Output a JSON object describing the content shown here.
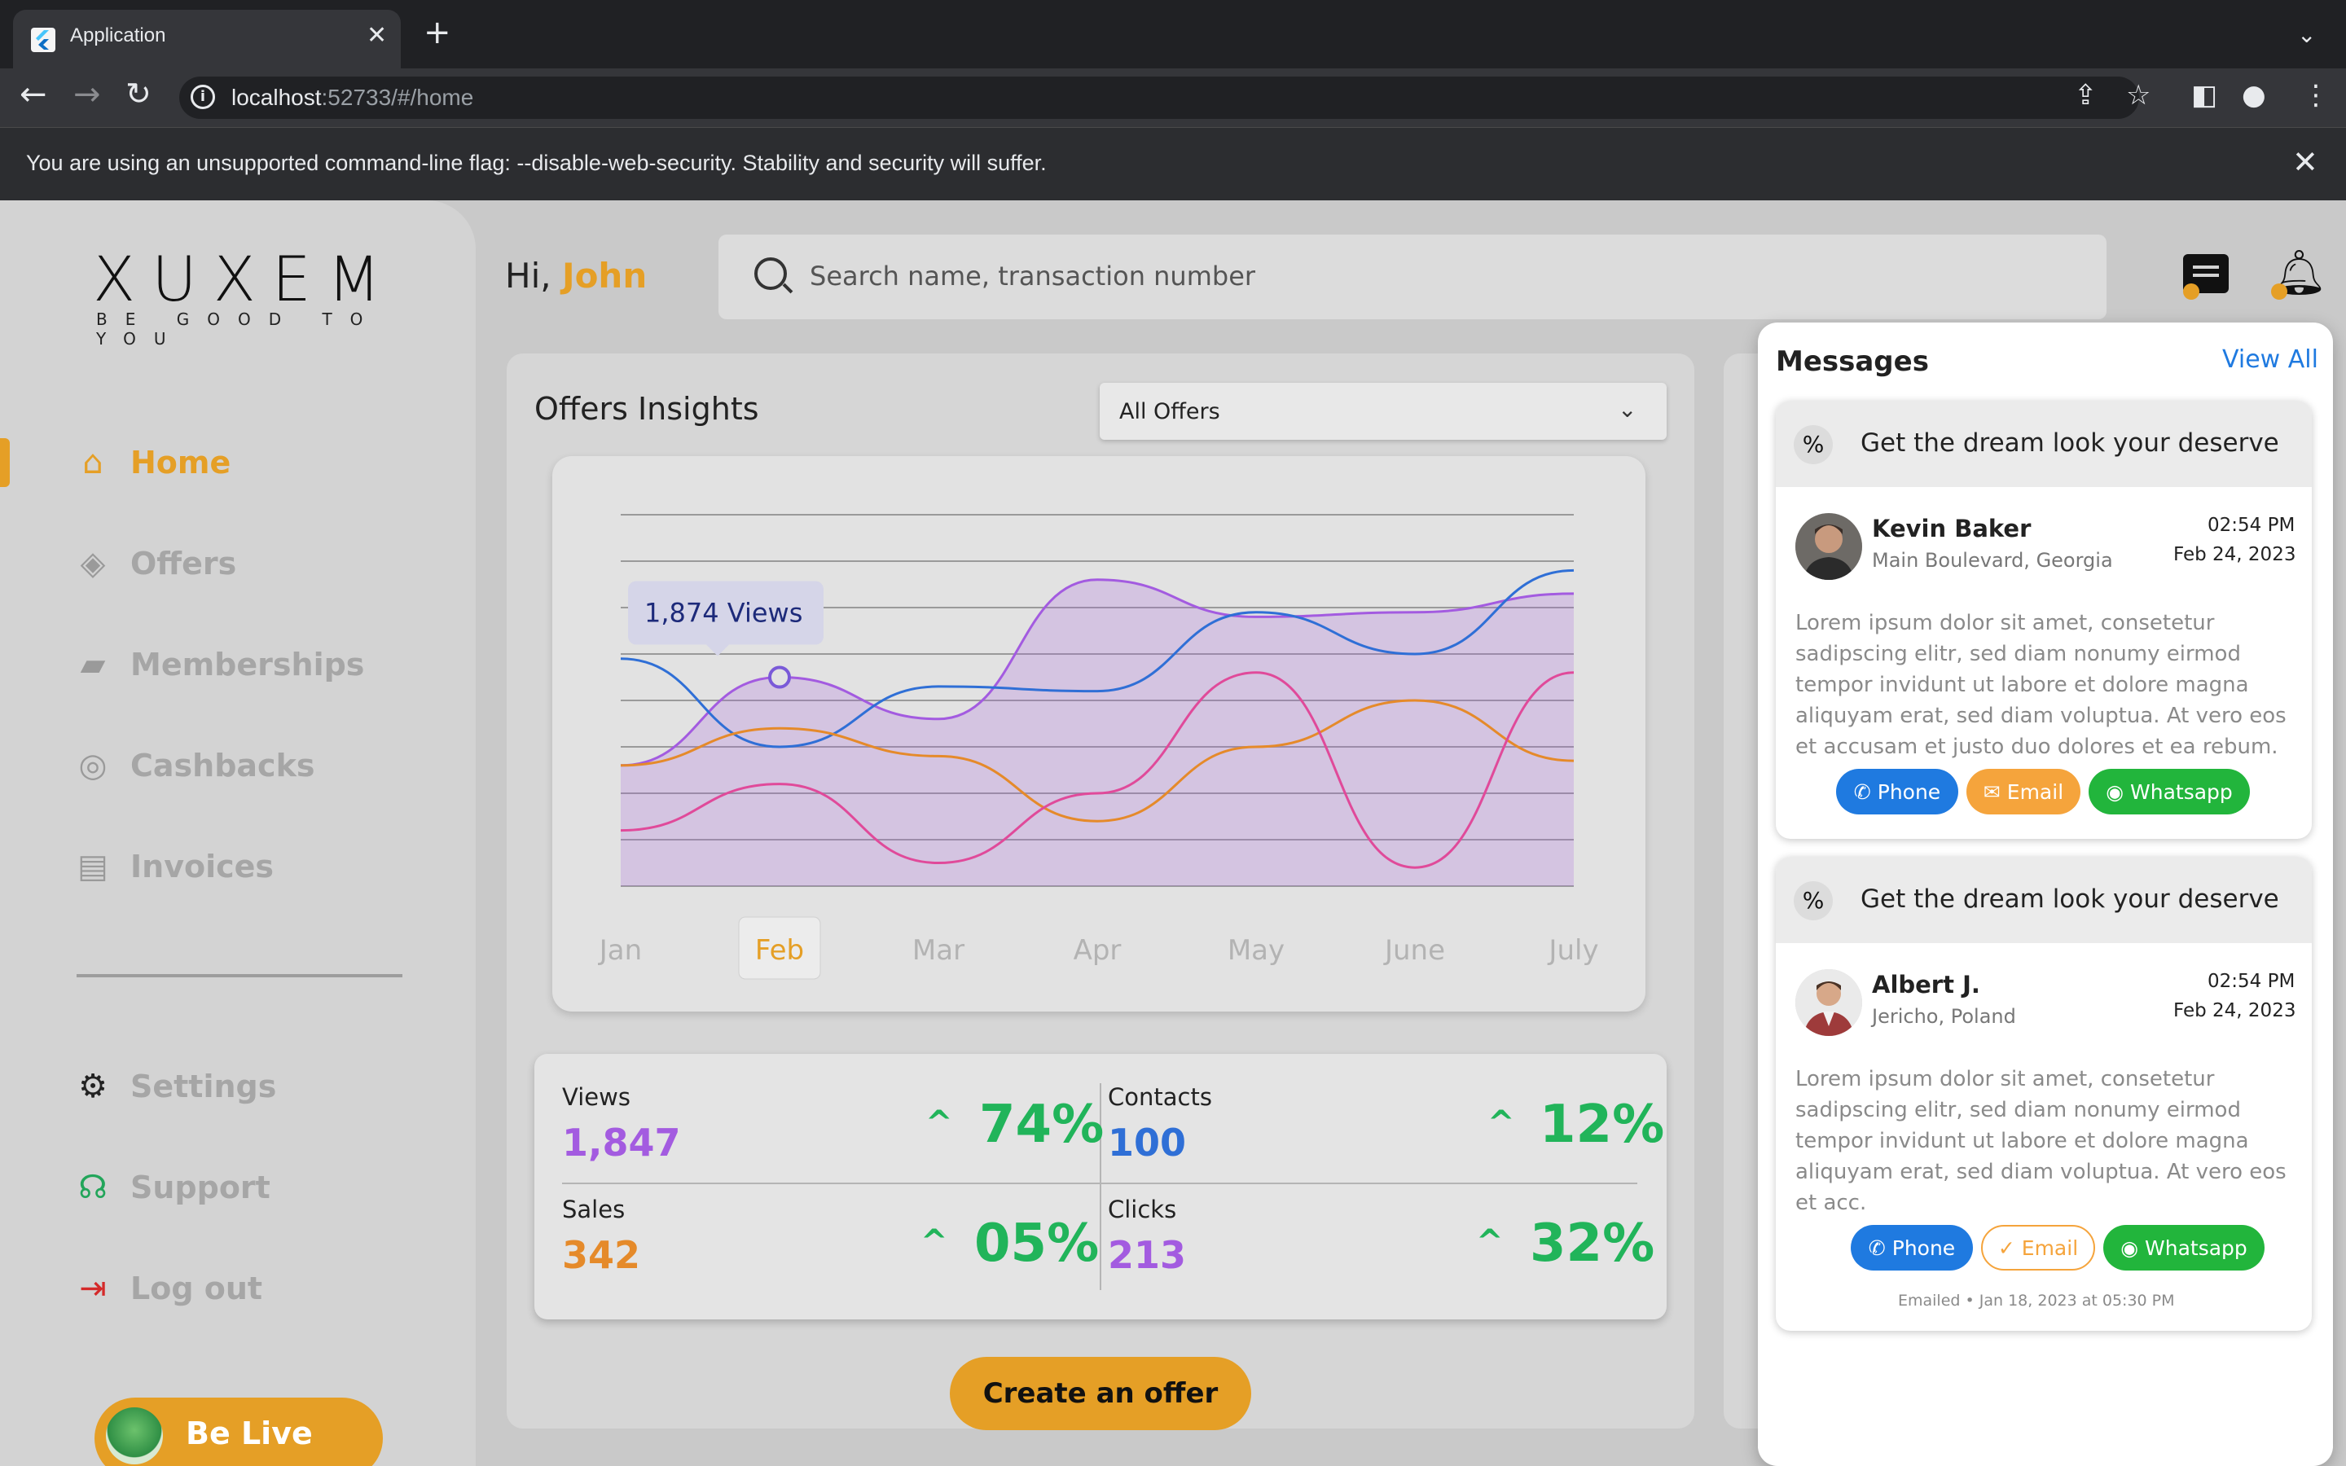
{
  "browser": {
    "tab_title": "Application",
    "url_host": "localhost",
    "url_rest": ":52733/#/home",
    "warning": "You are using an unsupported command-line flag: --disable-web-security. Stability and security will suffer."
  },
  "logo": {
    "wordmark": "XUXEM",
    "tagline": "BE GOOD TO YOU"
  },
  "header": {
    "greeting_prefix": "Hi, ",
    "user_name": "John",
    "search_placeholder": "Search name, transaction number"
  },
  "sidebar": {
    "items": [
      {
        "label": "Home",
        "icon": "home-icon",
        "active": true
      },
      {
        "label": "Offers",
        "icon": "tag-icon",
        "active": false
      },
      {
        "label": "Memberships",
        "icon": "card-icon",
        "active": false
      },
      {
        "label": "Cashbacks",
        "icon": "cashback-icon",
        "active": false
      },
      {
        "label": "Invoices",
        "icon": "invoice-icon",
        "active": false
      }
    ],
    "bottom_items": [
      {
        "label": "Settings",
        "icon": "gear-icon"
      },
      {
        "label": "Support",
        "icon": "headset-icon"
      },
      {
        "label": "Log out",
        "icon": "logout-icon"
      }
    ],
    "belive_label": "Be Live"
  },
  "insights": {
    "title": "Offers Insights",
    "filter_selected": "All Offers",
    "create_button": "Create an offer"
  },
  "chart_data": {
    "type": "line",
    "x": [
      "Jan",
      "Feb",
      "Mar",
      "Apr",
      "May",
      "June",
      "July"
    ],
    "selected_x": "Feb",
    "tooltip": "1,874 Views",
    "ylim": [
      0,
      8
    ],
    "grid": true,
    "series": [
      {
        "color": "#a35be0",
        "area": true,
        "values": [
          2.6,
          4.5,
          3.6,
          6.6,
          5.8,
          5.9,
          6.3
        ]
      },
      {
        "color": "#2f6fd6",
        "values": [
          4.9,
          3.0,
          4.3,
          4.2,
          5.9,
          5.0,
          6.8
        ]
      },
      {
        "color": "#e58a2a",
        "values": [
          2.6,
          3.4,
          2.8,
          1.4,
          3.0,
          4.0,
          2.7
        ]
      },
      {
        "color": "#e04a9a",
        "values": [
          1.2,
          2.2,
          0.5,
          2.0,
          4.6,
          0.4,
          4.6
        ]
      }
    ],
    "colors": {
      "primary": "#a35be0",
      "accent": "#e59f26"
    }
  },
  "stats": [
    {
      "label": "Views",
      "value": "1,847",
      "pct": "74%",
      "color": "#a35be0"
    },
    {
      "label": "Contacts",
      "value": "100",
      "pct": "12%",
      "color": "#2f6fd6"
    },
    {
      "label": "Sales",
      "value": "342",
      "pct": "05%",
      "color": "#e58a2a"
    },
    {
      "label": "Clicks",
      "value": "213",
      "pct": "32%",
      "color": "#a35be0"
    }
  ],
  "messages": {
    "title": "Messages",
    "view_all": "View All",
    "items": [
      {
        "headline": "Get the dream look your deserve",
        "name": "Kevin Baker",
        "location": "Main Boulevard, Georgia",
        "time": "02:54 PM",
        "date": "Feb 24, 2023",
        "body": "Lorem ipsum dolor sit amet, consetetur sadipscing elitr, sed diam nonumy eirmod tempor invidunt ut labore et dolore magna aliquyam erat, sed diam voluptua. At vero eos et accusam et justo duo dolores et ea rebum.",
        "phone": "Phone",
        "email": "Email",
        "whatsapp": "Whatsapp"
      },
      {
        "headline": "Get the dream look your deserve",
        "name": "Albert J.",
        "location": "Jericho, Poland",
        "time": "02:54 PM",
        "date": "Feb 24, 2023",
        "body": "Lorem ipsum dolor sit amet, consetetur sadipscing elitr, sed diam nonumy eirmod tempor invidunt ut labore et dolore magna aliquyam erat, sed diam voluptua. At vero eos et acc.",
        "phone": "Phone",
        "email": "Email",
        "whatsapp": "Whatsapp",
        "footer_status": "Emailed",
        "footer_time": "Jan 18, 2023 at 05:30 PM"
      }
    ]
  }
}
